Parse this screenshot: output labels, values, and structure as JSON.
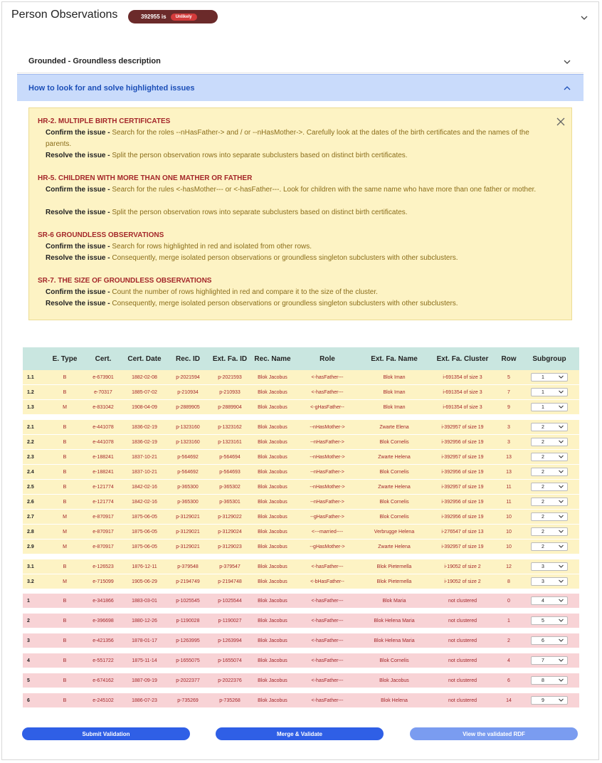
{
  "header": {
    "title": "Person Observations",
    "badge_id": "392955 is",
    "badge_status": "Unlikely"
  },
  "accordions": {
    "grounded_label": "Grounded - Groundless description",
    "howto_label": "How to look for and solve highlighted issues"
  },
  "issues": [
    {
      "title": "HR-2. MULTIPLE BIRTH CERTIFICATES",
      "confirm_label": "Confirm the issue -",
      "confirm_text": " Search for the roles --nHasFather-> and / or --nHasMother->. Carefully look at the dates of the birth certificates and the names of the parents.",
      "resolve_label": "Resolve the issue -",
      "resolve_text": " Split the person observation rows into separate subclusters based on distinct birth certificates."
    },
    {
      "title": "HR-5. CHILDREN WITH MORE THAN ONE MATHER OR FATHER",
      "confirm_label": "Confirm the issue -",
      "confirm_text": " Search for the rules <-hasMother--- or <-hasFather---. Look for children with the same name who have more than one father or mother.",
      "resolve_label": "Resolve the issue -",
      "resolve_text": " Split the person observation rows into separate subclusters based on distinct birth certificates."
    },
    {
      "title": "SR-6 GROUNDLESS OBSERVATIONS",
      "confirm_label": "Confirm the issue -",
      "confirm_text": " Search for rows highlighted in red and isolated from other rows.",
      "resolve_label": "Resolve the issue -",
      "resolve_text": " Consequently, merge isolated person observations or groundless singleton subclusters with other subclusters."
    },
    {
      "title": "SR-7. THE SIZE OF GROUNDLESS OBSERVATIONS",
      "confirm_label": "Confirm the issue -",
      "confirm_text": " Count the number of rows highlighted in red and compare it to the size of the cluster.",
      "resolve_label": "Resolve the issue -",
      "resolve_text": " Consequently, merge isolated person observations or groundless singleton subclusters with other subclusters."
    }
  ],
  "table": {
    "headers": [
      "",
      "E. Type",
      "Cert.",
      "Cert. Date",
      "Rec. ID",
      "Ext. Fa. ID",
      "Rec. Name",
      "Role",
      "Ext. Fa. Name",
      "Ext. Fa. Cluster",
      "Row",
      "Subgroup"
    ],
    "rows": [
      [
        "1.1",
        "B",
        "e-673901",
        "1882-02-08",
        "p-2021594",
        "p-2021593",
        "Blok Jacobus",
        "<-hasFather---",
        "Blok Iman",
        "i-691354 of size 3",
        "5",
        "1"
      ],
      [
        "1.2",
        "B",
        "e-70317",
        "1885-07-02",
        "p-210934",
        "p-210933",
        "Blok Jacobus",
        "<-hasFather---",
        "Blok Iman",
        "i-691354 of size 3",
        "7",
        "1"
      ],
      [
        "1.3",
        "M",
        "e-831042",
        "1908-04-09",
        "p-2889905",
        "p-2889904",
        "Blok Jacobus",
        "<-gHasFather--",
        "Blok Iman",
        "i-691354 of size 3",
        "9",
        "1"
      ],
      [
        "2.1",
        "B",
        "e-441078",
        "1836-02-19",
        "p-1323160",
        "p-1323162",
        "Blok Jacobus",
        "--nHasMother->",
        "Zwarte Elena",
        "i-392957 of size 19",
        "3",
        "2"
      ],
      [
        "2.2",
        "B",
        "e-441078",
        "1836-02-19",
        "p-1323160",
        "p-1323161",
        "Blok Jacobus",
        "--nHasFather->",
        "Blok Cornelis",
        "i-392956 of size 19",
        "3",
        "2"
      ],
      [
        "2.3",
        "B",
        "e-188241",
        "1837-10-21",
        "p-564692",
        "p-564694",
        "Blok Jacobus",
        "--nHasMother->",
        "Zwarte Helena",
        "i-392957 of size 19",
        "13",
        "2"
      ],
      [
        "2.4",
        "B",
        "e-188241",
        "1837-10-21",
        "p-564692",
        "p-564693",
        "Blok Jacobus",
        "--nHasFather->",
        "Blok Cornelis",
        "i-392956 of size 19",
        "13",
        "2"
      ],
      [
        "2.5",
        "B",
        "e-121774",
        "1842-02-16",
        "p-365300",
        "p-365302",
        "Blok Jacobus",
        "--nHasMother->",
        "Zwarte Helena",
        "i-392957 of size 19",
        "11",
        "2"
      ],
      [
        "2.6",
        "B",
        "e-121774",
        "1842-02-16",
        "p-365300",
        "p-365301",
        "Blok Jacobus",
        "--nHasFather->",
        "Blok Cornelis",
        "i-392956 of size 19",
        "11",
        "2"
      ],
      [
        "2.7",
        "M",
        "e-870917",
        "1875-06-05",
        "p-3129021",
        "p-3129022",
        "Blok Jacobus",
        "--gHasFather->",
        "Blok Cornelis",
        "i-392956 of size 19",
        "10",
        "2"
      ],
      [
        "2.8",
        "M",
        "e-870917",
        "1875-06-05",
        "p-3129021",
        "p-3129024",
        "Blok Jacobus",
        "<---married----",
        "Verbrugge Helena",
        "i-276547 of size 13",
        "10",
        "2"
      ],
      [
        "2.9",
        "M",
        "e-870917",
        "1875-06-05",
        "p-3129021",
        "p-3129023",
        "Blok Jacobus",
        "--gHasMother->",
        "Zwarte Helena",
        "i-392957 of size 19",
        "10",
        "2"
      ],
      [
        "3.1",
        "B",
        "e-126523",
        "1876-12-11",
        "p-379548",
        "p-379547",
        "Blok Jacobus",
        "<-hasFather---",
        "Blok Pieternella",
        "i-19052 of size 2",
        "12",
        "3"
      ],
      [
        "3.2",
        "M",
        "e-715099",
        "1905-06-29",
        "p-2194749",
        "p-2194748",
        "Blok Jacobus",
        "<-bHasFather--",
        "Blok Pieternella",
        "i-19052 of size 2",
        "8",
        "3"
      ],
      [
        "1",
        "B",
        "e-341866",
        "1883-03-01",
        "p-1025545",
        "p-1025544",
        "Blok Jacobus",
        "<-hasFather---",
        "Blok Maria",
        "not clustered",
        "0",
        "4"
      ],
      [
        "2",
        "B",
        "e-396698",
        "1880-12-26",
        "p-1190028",
        "p-1190027",
        "Blok Jacobus",
        "<-hasFather---",
        "Blok Helena Maria",
        "not clustered",
        "1",
        "5"
      ],
      [
        "3",
        "B",
        "e-421356",
        "1878-01-17",
        "p-1263995",
        "p-1263994",
        "Blok Jacobus",
        "<-hasFather---",
        "Blok Helena Maria",
        "not clustered",
        "2",
        "6"
      ],
      [
        "4",
        "B",
        "e-551722",
        "1875-11-14",
        "p-1655075",
        "p-1655074",
        "Blok Jacobus",
        "<-hasFather---",
        "Blok Cornelis",
        "not clustered",
        "4",
        "7"
      ],
      [
        "5",
        "B",
        "e-674162",
        "1887-09-19",
        "p-2022377",
        "p-2022376",
        "Blok Jacobus",
        "<-hasFather---",
        "Blok Jacobus",
        "not clustered",
        "6",
        "8"
      ],
      [
        "6",
        "B",
        "e-245102",
        "1886-07-23",
        "p-735269",
        "p-735268",
        "Blok Jacobus",
        "<-hasFather---",
        "Blok Helena",
        "not clustered",
        "14",
        "9"
      ]
    ]
  },
  "buttons": {
    "submit": "Submit Validation",
    "merge": "Merge & Validate",
    "view": "View the validated RDF"
  },
  "colors": {
    "primary": "#2f5fe6",
    "primary_light": "#7a9cf0",
    "grounded_row": "#fdf3c4",
    "groundless_row": "#f8d3d6",
    "header_bg": "#c9e6e0"
  }
}
